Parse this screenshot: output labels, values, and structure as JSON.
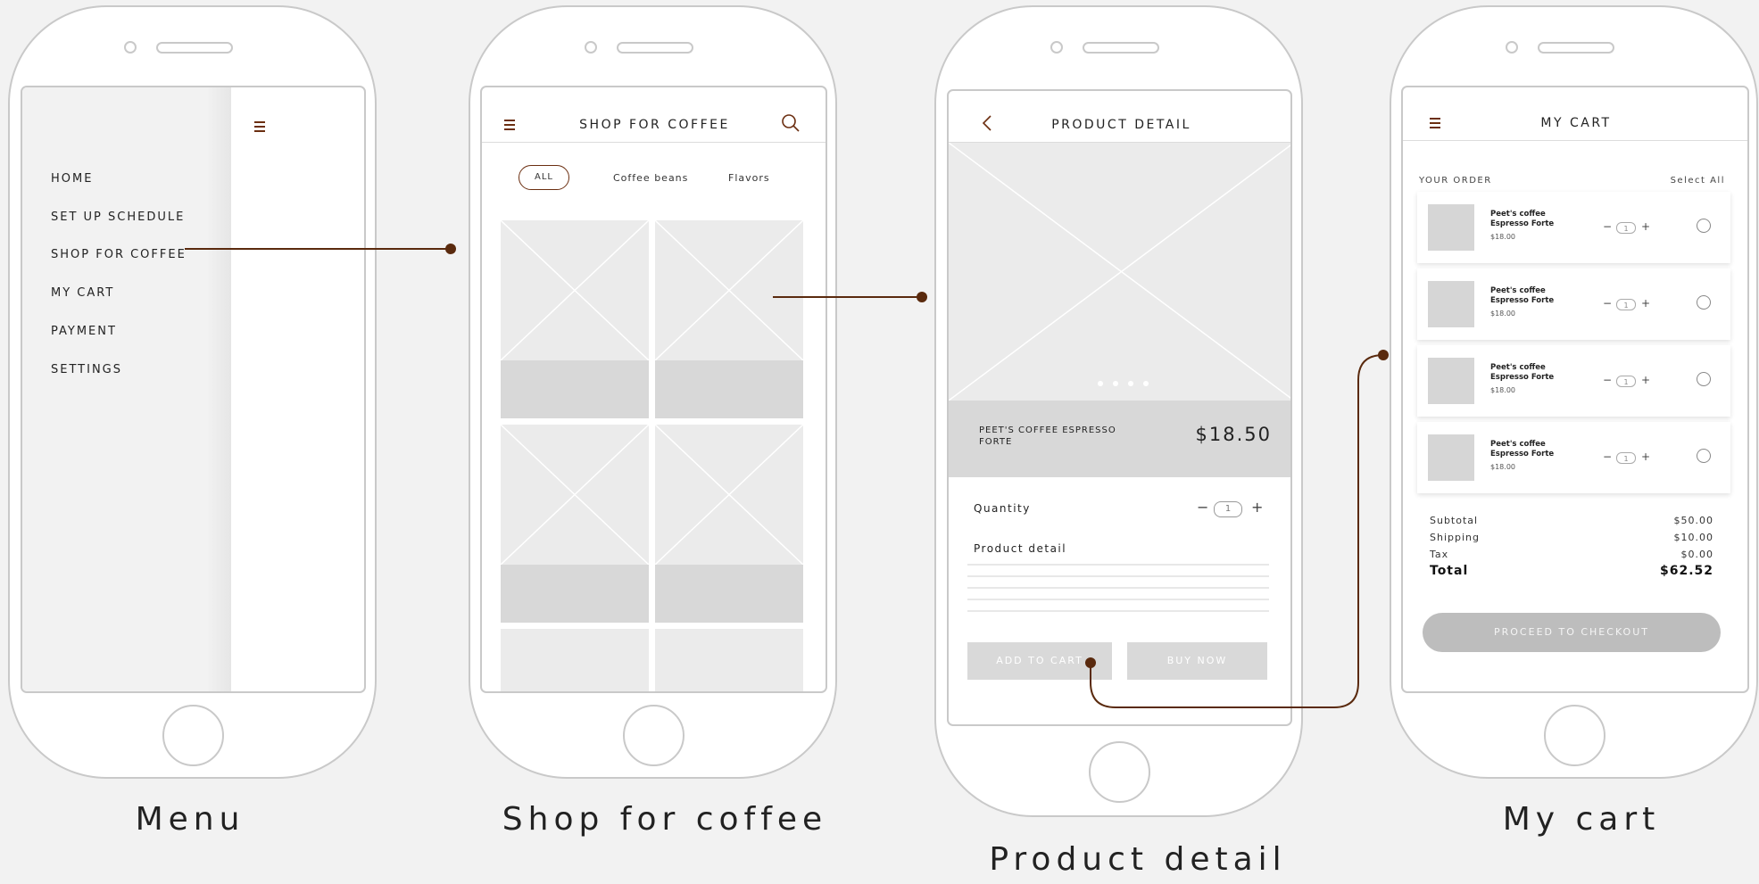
{
  "captions": {
    "menu": "Menu",
    "shop": "Shop for coffee",
    "product": "Product detail",
    "cart": "My cart"
  },
  "menu_screen": {
    "items": [
      {
        "label": "HOME"
      },
      {
        "label": "SET UP SCHEDULE"
      },
      {
        "label": "SHOP FOR COFFEE"
      },
      {
        "label": "MY CART"
      },
      {
        "label": "PAYMENT"
      },
      {
        "label": "SETTINGS"
      }
    ],
    "icon": "hamburger-icon"
  },
  "shop_screen": {
    "title": "SHOP FOR COFFEE",
    "filters": [
      {
        "label": "ALL",
        "selected": true
      },
      {
        "label": "Coffee beans"
      },
      {
        "label": "Flavors"
      }
    ],
    "icons": [
      "hamburger-icon",
      "search-icon"
    ]
  },
  "product_screen": {
    "title": "PRODUCT DETAIL",
    "product_name": "PEET'S COFFEE ESPRESSO FORTE",
    "price": "$18.50",
    "quantity_label": "Quantity",
    "quantity_minus": "−",
    "quantity_value": "1",
    "quantity_plus": "+",
    "detail_label": "Product detail",
    "add_to_cart": "ADD TO CART",
    "buy_now": "BUY NOW",
    "icons": [
      "back-chevron-icon"
    ]
  },
  "cart_screen": {
    "title": "MY CART",
    "your_order": "YOUR ORDER",
    "select_all": "Select All",
    "items": [
      {
        "name": "Peet's coffee Espresso Forte",
        "price": "$18.00",
        "minus": "−",
        "qty": "1",
        "plus": "+"
      },
      {
        "name": "Peet's coffee Espresso Forte",
        "price": "$18.00",
        "minus": "−",
        "qty": "1",
        "plus": "+"
      },
      {
        "name": "Peet's coffee Espresso Forte",
        "price": "$18.00",
        "minus": "−",
        "qty": "1",
        "plus": "+"
      },
      {
        "name": "Peet's coffee Espresso Forte",
        "price": "$18.00",
        "minus": "−",
        "qty": "1",
        "plus": "+"
      }
    ],
    "summary": {
      "subtotal_label": "Subtotal",
      "subtotal": "$50.00",
      "shipping_label": "Shipping",
      "shipping": "$10.00",
      "tax_label": "Tax",
      "tax": "$0.00",
      "total_label": "Total",
      "total": "$62.52"
    },
    "checkout": "PROCEED TO CHECKOUT",
    "icons": [
      "hamburger-icon"
    ]
  },
  "colors": {
    "accent": "#6b2e10",
    "connector": "#5a2a0e",
    "placeholder": "#ebebeb",
    "placeholder_dark": "#d8d8d8",
    "button_disabled": "#d9d9d9",
    "checkout_button": "#bdbdbd",
    "background": "#f2f2f2"
  }
}
